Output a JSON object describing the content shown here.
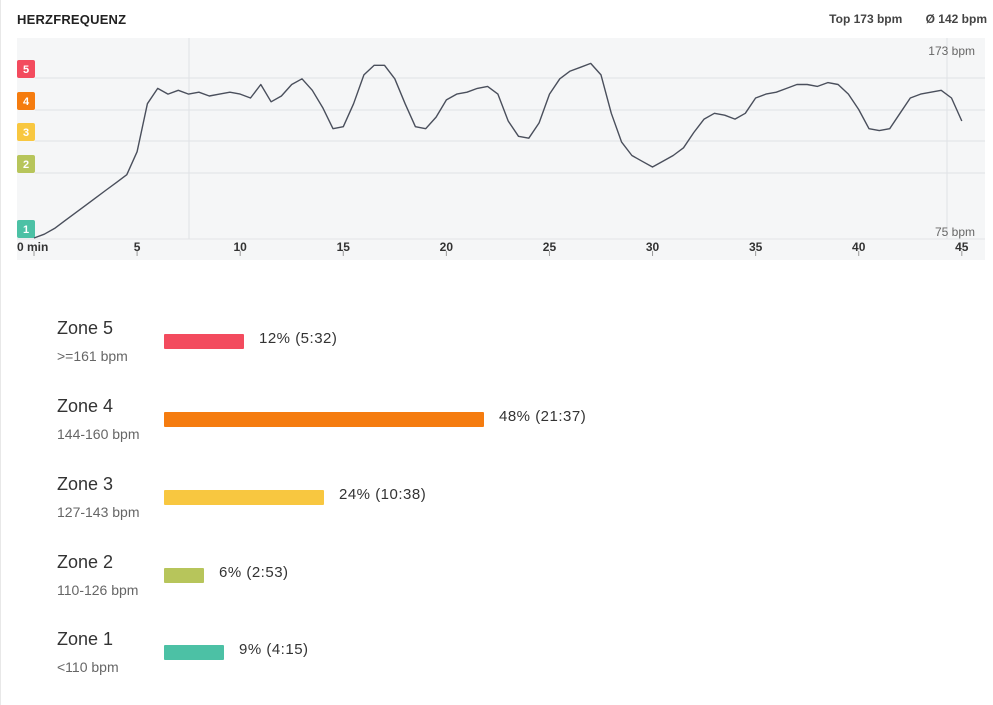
{
  "header": {
    "title": "HERZFREQUENZ",
    "top": "Top 173 bpm",
    "avg": "Ø 142 bpm"
  },
  "colors": {
    "zone5": "#f34b5e",
    "zone4": "#f57c0f",
    "zone3": "#f8c740",
    "zone2": "#b7c55b",
    "zone1": "#4cc1a5",
    "line": "#4a4f5c",
    "plot_bg": "#f5f6f7",
    "grid": "#e0e2e5"
  },
  "chart_data": {
    "type": "line",
    "title": "HERZFREQUENZ",
    "xlabel": "",
    "ylabel": "",
    "xlim": [
      0,
      45.3
    ],
    "ylim": [
      75,
      173
    ],
    "y_top_label": "173 bpm",
    "y_bottom_label": "75 bpm",
    "x_ticks": [
      0,
      5,
      10,
      15,
      20,
      25,
      30,
      35,
      40,
      45
    ],
    "x_tick_labels": [
      "0 min",
      "5",
      "10",
      "15",
      "20",
      "25",
      "30",
      "35",
      "40",
      "45"
    ],
    "zone_thresholds": [
      {
        "zone": "5",
        "bpm": 161
      },
      {
        "zone": "4",
        "bpm": 144
      },
      {
        "zone": "3",
        "bpm": 127
      },
      {
        "zone": "2",
        "bpm": 110
      },
      {
        "zone": "1",
        "bpm": 75
      }
    ],
    "series": [
      {
        "x": [
          0,
          0.5,
          1,
          1.5,
          2,
          2.5,
          3,
          3.5,
          4,
          4.5,
          5,
          5.5,
          6,
          6.5,
          7,
          7.5,
          8,
          8.5,
          9,
          9.5,
          10,
          10.5,
          11,
          11.5,
          12,
          12.5,
          13,
          13.5,
          14,
          14.5,
          15,
          15.5,
          16,
          16.5,
          17,
          17.5,
          18,
          18.5,
          19,
          19.5,
          20,
          20.5,
          21,
          21.5,
          22,
          22.5,
          23,
          23.5,
          24,
          24.5,
          25,
          25.5,
          26,
          26.5,
          27,
          27.5,
          28,
          28.5,
          29,
          29.5,
          30,
          30.5,
          31,
          31.5,
          32,
          32.5,
          33,
          33.5,
          34,
          34.5,
          35,
          35.5,
          36,
          36.5,
          37,
          37.5,
          38,
          38.5,
          39,
          39.5,
          40,
          40.5,
          41,
          41.5,
          42,
          42.5,
          43,
          43.5,
          44,
          44.5,
          45
        ],
        "y": [
          75,
          77,
          80,
          84,
          88,
          92,
          96,
          100,
          104,
          108,
          120,
          145,
          153,
          150,
          152,
          150,
          151,
          149,
          150,
          151,
          150,
          148,
          155,
          146,
          149,
          155,
          158,
          152,
          143,
          132,
          133,
          145,
          160,
          165,
          165,
          158,
          145,
          133,
          132,
          138,
          147,
          150,
          151,
          153,
          154,
          150,
          136,
          128,
          127,
          135,
          150,
          158,
          162,
          164,
          166,
          160,
          140,
          125,
          118,
          115,
          112,
          115,
          118,
          122,
          130,
          137,
          140,
          139,
          137,
          140,
          148,
          150,
          151,
          153,
          155,
          155,
          154,
          156,
          155,
          150,
          142,
          132,
          131,
          132,
          140,
          148,
          150,
          151,
          152,
          148,
          136
        ]
      }
    ]
  },
  "zones": [
    {
      "name": "Zone 5",
      "range": ">=161 bpm",
      "value_text": "12% (5:32)",
      "share": 0.12,
      "color": "#f34b5e"
    },
    {
      "name": "Zone 4",
      "range": "144-160 bpm",
      "value_text": "48% (21:37)",
      "share": 0.48,
      "color": "#f57c0f"
    },
    {
      "name": "Zone 3",
      "range": "127-143 bpm",
      "value_text": "24% (10:38)",
      "share": 0.24,
      "color": "#f8c740"
    },
    {
      "name": "Zone 2",
      "range": "110-126 bpm",
      "value_text": "6% (2:53)",
      "share": 0.06,
      "color": "#b7c55b"
    },
    {
      "name": "Zone 1",
      "range": "<110 bpm",
      "value_text": "9% (4:15)",
      "share": 0.09,
      "color": "#4cc1a5"
    }
  ]
}
